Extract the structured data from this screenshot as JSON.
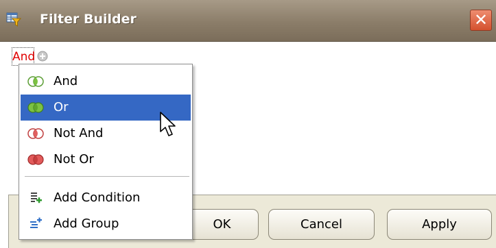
{
  "window": {
    "title": "Filter Builder",
    "close_glyph": "✕",
    "icon": "filter-builder-icon"
  },
  "builder": {
    "group_operator": "And",
    "add_icon": "add-circle-icon"
  },
  "menu": {
    "items": [
      {
        "label": "And",
        "icon": "and-venn-icon",
        "selected": false
      },
      {
        "label": "Or",
        "icon": "or-venn-icon",
        "selected": true
      },
      {
        "label": "Not And",
        "icon": "not-and-venn-icon",
        "selected": false
      },
      {
        "label": "Not Or",
        "icon": "not-or-venn-icon",
        "selected": false
      }
    ],
    "actions": [
      {
        "label": "Add Condition",
        "icon": "add-condition-icon"
      },
      {
        "label": "Add Group",
        "icon": "add-group-icon"
      }
    ]
  },
  "buttons": {
    "ok": "OK",
    "cancel": "Cancel",
    "apply": "Apply"
  },
  "colors": {
    "accent": "#3568c4",
    "group_operator": "#e00000",
    "title_bar": "#8b7d69",
    "close_button": "#d4512e"
  }
}
